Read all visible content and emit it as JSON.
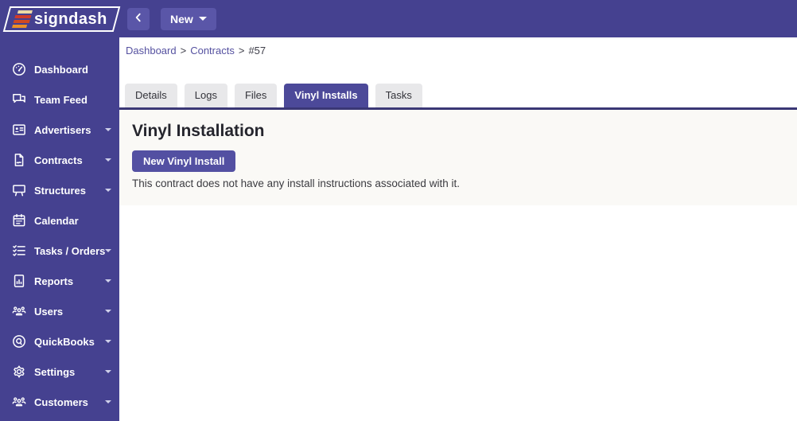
{
  "app": {
    "brand": "signdash"
  },
  "topbar": {
    "new_button_label": "New"
  },
  "breadcrumb": {
    "separator": ">",
    "items": [
      {
        "label": "Dashboard",
        "link": true
      },
      {
        "label": "Contracts",
        "link": true
      },
      {
        "label": "#57",
        "link": false
      }
    ]
  },
  "sidebar": {
    "items": [
      {
        "label": "Dashboard",
        "icon": "dashboard-icon",
        "has_submenu": false
      },
      {
        "label": "Team Feed",
        "icon": "team-feed-icon",
        "has_submenu": false
      },
      {
        "label": "Advertisers",
        "icon": "advertisers-icon",
        "has_submenu": true
      },
      {
        "label": "Contracts",
        "icon": "contracts-icon",
        "has_submenu": true
      },
      {
        "label": "Structures",
        "icon": "structures-icon",
        "has_submenu": true
      },
      {
        "label": "Calendar",
        "icon": "calendar-icon",
        "has_submenu": false
      },
      {
        "label": "Tasks / Orders",
        "icon": "tasks-icon",
        "has_submenu": true
      },
      {
        "label": "Reports",
        "icon": "reports-icon",
        "has_submenu": true
      },
      {
        "label": "Users",
        "icon": "users-icon",
        "has_submenu": true
      },
      {
        "label": "QuickBooks",
        "icon": "quickbooks-icon",
        "has_submenu": true
      },
      {
        "label": "Settings",
        "icon": "settings-icon",
        "has_submenu": true
      },
      {
        "label": "Customers",
        "icon": "customers-icon",
        "has_submenu": true
      }
    ]
  },
  "tabs": [
    {
      "label": "Details",
      "active": false
    },
    {
      "label": "Logs",
      "active": false
    },
    {
      "label": "Files",
      "active": false
    },
    {
      "label": "Vinyl Installs",
      "active": true
    },
    {
      "label": "Tasks",
      "active": false
    }
  ],
  "content": {
    "heading": "Vinyl Installation",
    "new_install_button": "New Vinyl Install",
    "empty_message": "This contract does not have any install instructions associated with it."
  },
  "colors": {
    "primary_purple": "#454190",
    "button_purple": "#5a56a8",
    "active_tab_purple": "#4c4999",
    "tab_underline": "#3a3775",
    "panel_background": "#faf9f6",
    "logo_bar_colors": [
      "#ecd9a5",
      "#cf3a2a",
      "#d04a22",
      "#ec9126"
    ]
  }
}
